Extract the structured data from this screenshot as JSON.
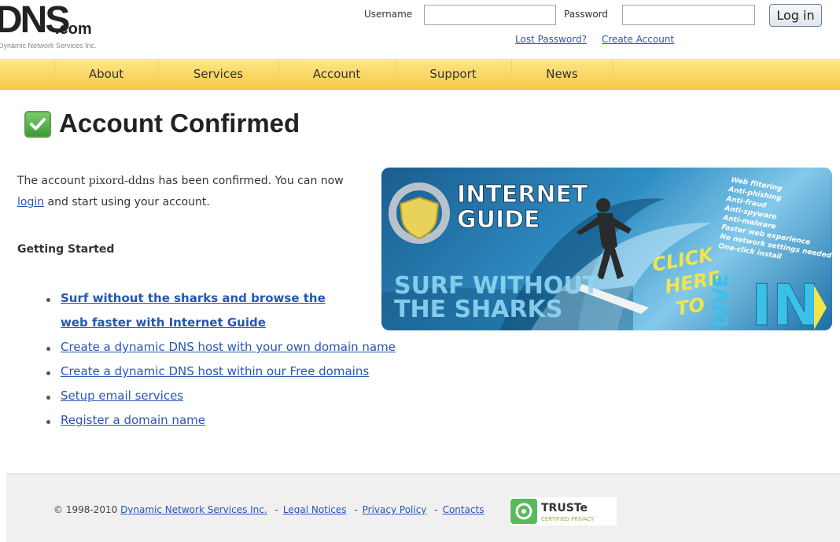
{
  "header": {
    "logo_main": "DNS",
    "logo_suffix": ".com",
    "logo_tagline": "Dynamic Network Services Inc.",
    "username_label": "Username",
    "password_label": "Password",
    "username_value": "",
    "password_value": "",
    "login_button": "Log in",
    "lost_password": "Lost Password?",
    "create_account": "Create Account"
  },
  "nav": {
    "items": [
      "About",
      "Services",
      "Account",
      "Support",
      "News"
    ]
  },
  "main": {
    "title": "Account Confirmed",
    "text_before": "The account ",
    "account_name": "pixord-ddns",
    "text_middle": " has been confirmed. You can now ",
    "login_link": "login",
    "text_after": " and start using your account.",
    "section_heading": "Getting Started",
    "links": [
      "Surf without the sharks and browse the",
      "web faster with Internet Guide",
      "Create a dynamic DNS host with your own domain name",
      "Create a dynamic DNS host within our Free domains",
      "Setup email services",
      "Register a domain name"
    ]
  },
  "banner": {
    "title_line1": "INTERNET",
    "title_line2": "GUIDE",
    "features": [
      "Web filtering",
      "Anti-phishing",
      "Anti-fraud",
      "Anti-spyware",
      "Anti-malware",
      "Faster web experience",
      "No network settings needed",
      "One-click install"
    ],
    "surf_line1": "SURF WITHOUT",
    "surf_line2": "THE SHARKS",
    "click_line1": "CLICK",
    "click_line2": "HERE",
    "click_line3": "TO",
    "dive": "DIVE",
    "in": "IN"
  },
  "footer": {
    "copyright": "© 1998-2010",
    "company_link": "Dynamic Network Services Inc.",
    "dash": "-",
    "legal": "Legal Notices",
    "privacy": "Privacy Policy",
    "contacts": "Contacts",
    "truste_name": "TRUSTe",
    "truste_sub": "CERTIFIED PRIVACY"
  },
  "colors": {
    "nav_gradient_top": "#fde888",
    "nav_gradient_bottom": "#f7c94a",
    "link": "#2855b5",
    "check_green": "#4caf3f"
  }
}
